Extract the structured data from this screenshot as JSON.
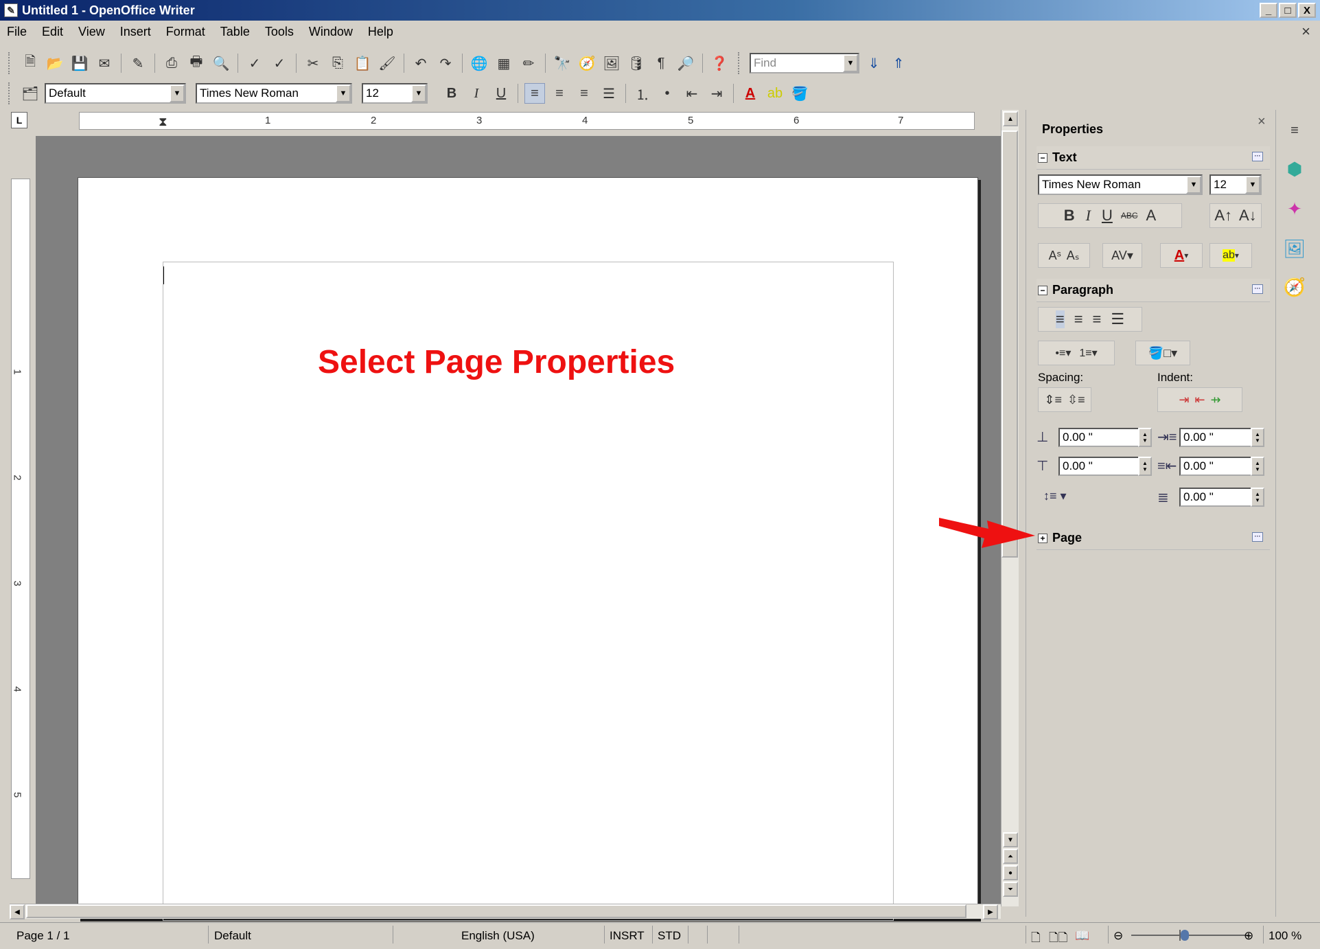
{
  "window": {
    "title": "Untitled 1 - OpenOffice Writer",
    "controls": {
      "minimize": "_",
      "maximize": "□",
      "close": "X"
    }
  },
  "menubar": {
    "items": [
      "File",
      "Edit",
      "View",
      "Insert",
      "Format",
      "Table",
      "Tools",
      "Window",
      "Help"
    ],
    "doc_close": "×"
  },
  "toolbar_standard": {
    "find_placeholder": "Find"
  },
  "toolbar_format": {
    "style": "Default",
    "font": "Times New Roman",
    "size": "12",
    "bold": "B",
    "italic": "I",
    "underline": "U"
  },
  "ruler": {
    "labels": [
      "1",
      "2",
      "3",
      "4",
      "5",
      "6",
      "7"
    ]
  },
  "vruler": {
    "labels": [
      "1",
      "2",
      "3",
      "4",
      "5"
    ]
  },
  "document": {
    "callout": "Select Page Properties"
  },
  "sidebar": {
    "title": "Properties",
    "close": "×",
    "text_panel": {
      "title": "Text",
      "font": "Times New Roman",
      "size": "12"
    },
    "paragraph_panel": {
      "title": "Paragraph",
      "spacing_label": "Spacing:",
      "indent_label": "Indent:",
      "above": "0.00 \"",
      "below": "0.00 \"",
      "before_text": "0.00 \"",
      "after_text": "0.00 \"",
      "first_line": "0.00 \""
    },
    "page_panel": {
      "title": "Page"
    }
  },
  "statusbar": {
    "page": "Page 1 / 1",
    "style": "Default",
    "language": "English (USA)",
    "insert_mode": "INSRT",
    "selection_mode": "STD",
    "zoom": "100 %"
  },
  "colors": {
    "accent_red": "#ee1111",
    "titlebar": "#0a246a"
  }
}
